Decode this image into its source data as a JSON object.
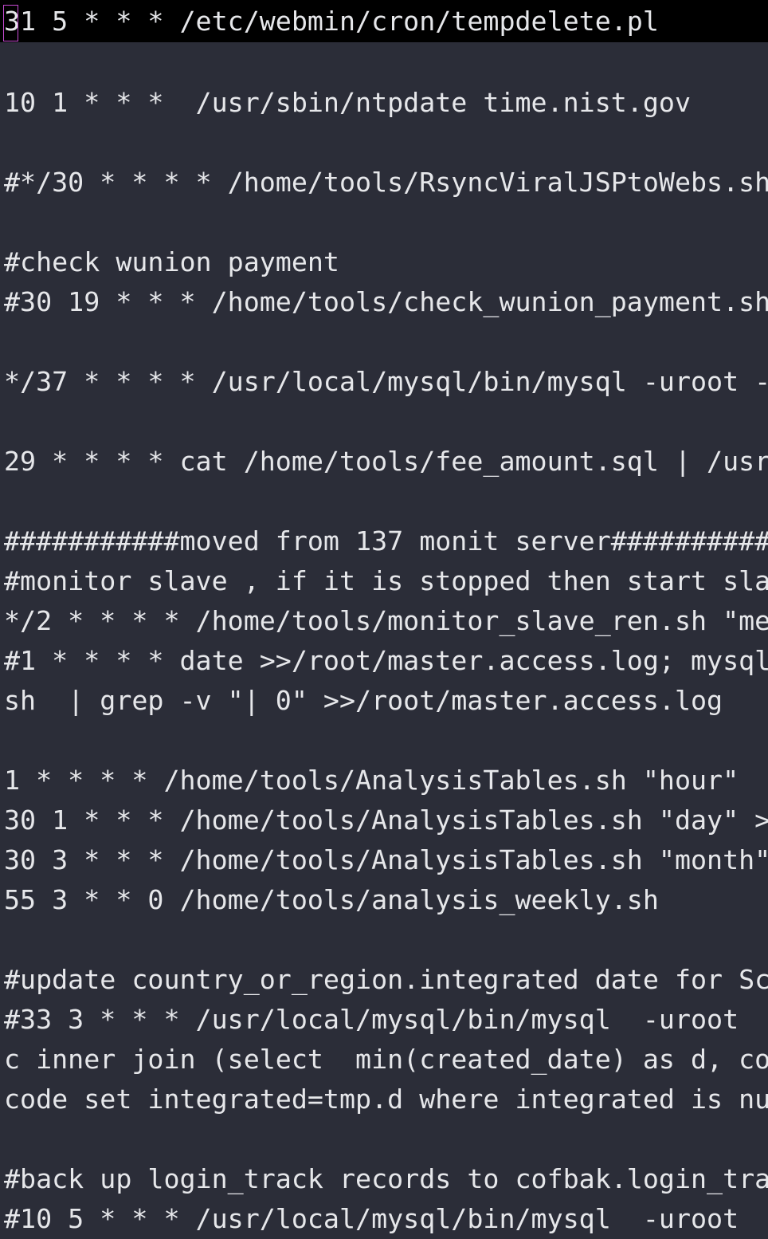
{
  "editor": {
    "lines": [
      "31 5 * * * /etc/webmin/cron/tempdelete.pl",
      "",
      "10 1 * * *  /usr/sbin/ntpdate time.nist.gov",
      "",
      "#*/30 * * * * /home/tools/RsyncViralJSPtoWebs.sh",
      "",
      "#check wunion payment",
      "#30 19 * * * /home/tools/check_wunion_payment.sh",
      "",
      "*/37 * * * * /usr/local/mysql/bin/mysql -uroot -",
      "",
      "29 * * * * cat /home/tools/fee_amount.sql | /usr",
      "",
      "###########moved from 137 monit server##########",
      "#monitor slave , if it is stopped then start sla",
      "*/2 * * * * /home/tools/monitor_slave_ren.sh \"me",
      "#1 * * * * date >>/root/master.access.log; mysql",
      "sh  | grep -v \"| 0\" >>/root/master.access.log",
      "",
      "1 * * * * /home/tools/AnalysisTables.sh \"hour\"",
      "30 1 * * * /home/tools/AnalysisTables.sh \"day\" >",
      "30 3 * * * /home/tools/AnalysisTables.sh \"month\"",
      "55 3 * * 0 /home/tools/analysis_weekly.sh",
      "",
      "#update country_or_region.integrated date for Sc",
      "#33 3 * * * /usr/local/mysql/bin/mysql  -uroot",
      "c inner join (select  min(created_date) as d, co",
      "code set integrated=tmp.d where integrated is nu",
      "",
      "#back up login_track records to cofbak.login_tra",
      "#10 5 * * * /usr/local/mysql/bin/mysql  -uroot"
    ]
  },
  "colors": {
    "background": "#2b2d38",
    "text": "#e6e7ea",
    "current_line": "#000000",
    "cursor": "#c64bd2"
  }
}
